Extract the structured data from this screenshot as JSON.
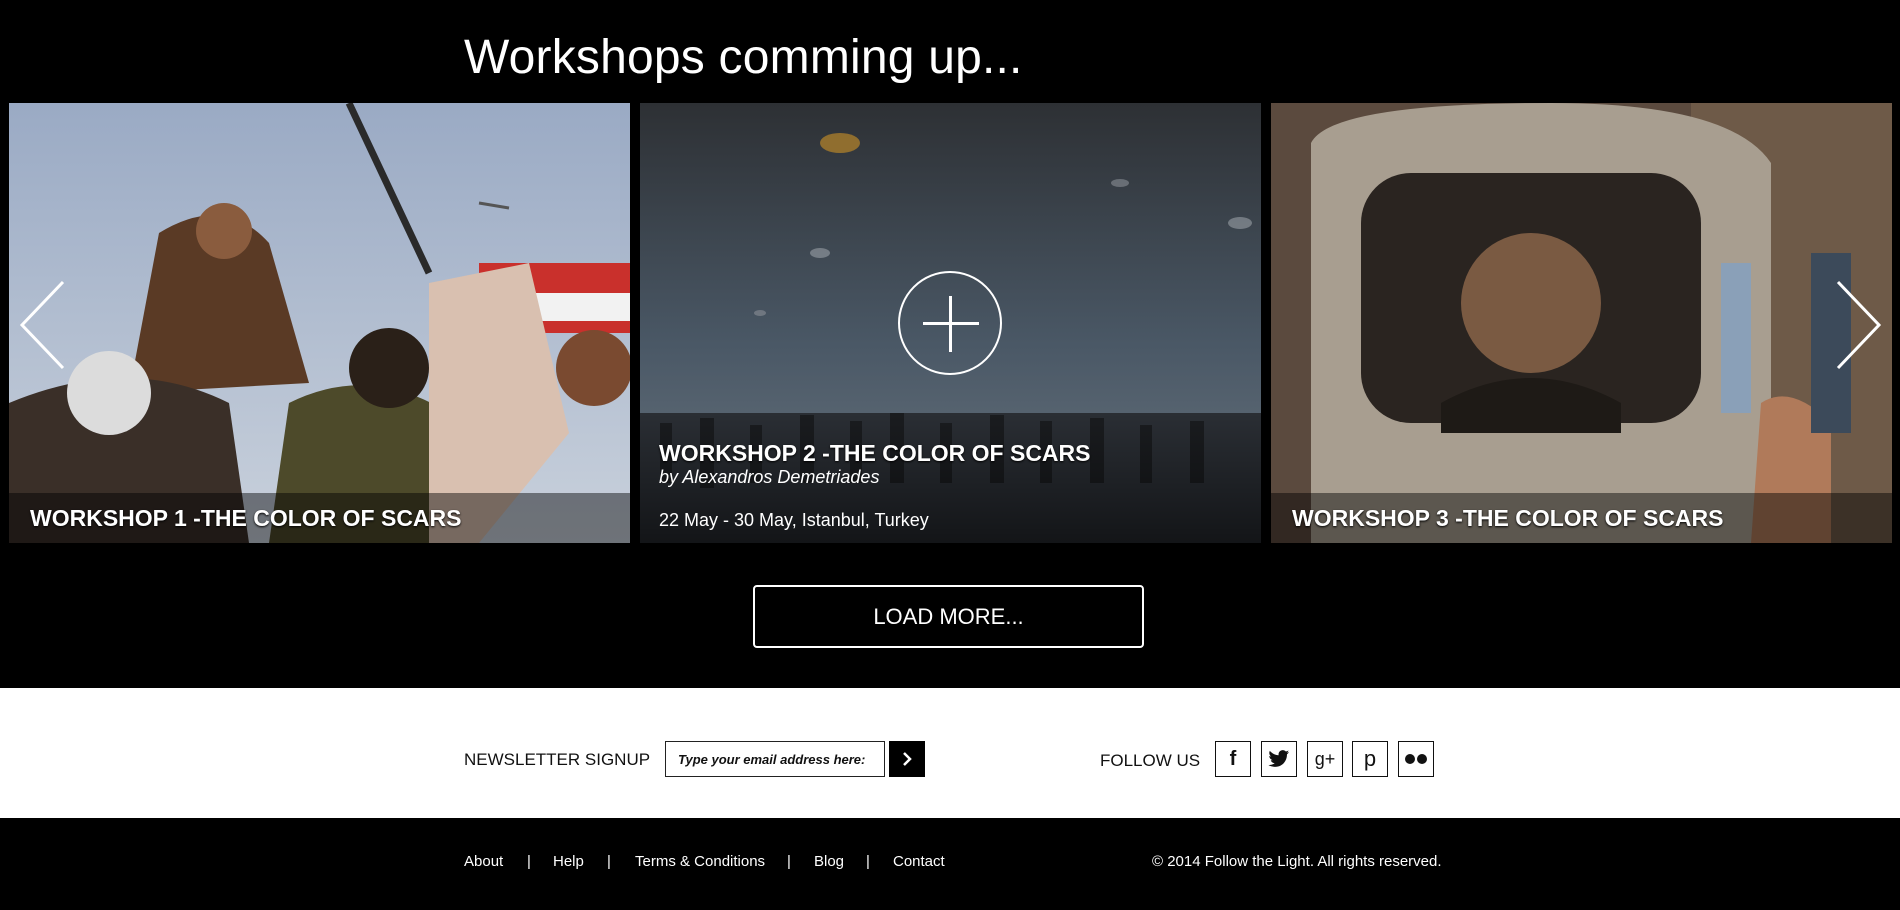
{
  "header": {
    "title": "Workshops comming up..."
  },
  "workshops": [
    {
      "title": "WORKSHOP 1 -THE COLOR OF SCARS"
    },
    {
      "title": "WORKSHOP 2 -THE COLOR OF SCARS",
      "author": "by Alexandros Demetriades",
      "date": "22 May - 30 May, Istanbul, Turkey"
    },
    {
      "title": "WORKSHOP 3 -THE COLOR OF SCARS"
    }
  ],
  "carousel": {
    "prev_icon": "chevron-left-icon",
    "next_icon": "chevron-right-icon",
    "open_icon": "plus-icon"
  },
  "load_more": {
    "label": "LOAD MORE..."
  },
  "newsletter": {
    "label": "NEWSLETTER SIGNUP",
    "placeholder": "Type your email address here:",
    "submit_icon": "chevron-right-icon"
  },
  "follow": {
    "label": "FOLLOW US",
    "networks": [
      {
        "icon": "facebook-icon",
        "glyph": "f"
      },
      {
        "icon": "twitter-icon",
        "glyph": ""
      },
      {
        "icon": "google-plus-icon",
        "glyph": "g+"
      },
      {
        "icon": "pinterest-icon",
        "glyph": "p"
      },
      {
        "icon": "flickr-icon",
        "glyph": ""
      }
    ]
  },
  "footer": {
    "links": [
      "About",
      "Help",
      "Terms & Conditions",
      "Blog",
      "Contact"
    ],
    "separator": "|",
    "copyright": "© 2014 Follow the Light. All rights reserved."
  },
  "colors": {
    "background": "#000000",
    "text": "#ffffff",
    "newsletter_bg": "#ffffff"
  }
}
